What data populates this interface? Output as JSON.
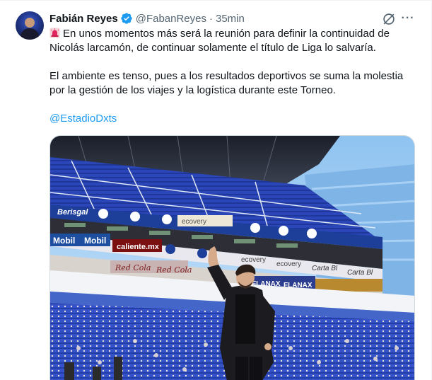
{
  "tweet": {
    "author_name": "Fabián Reyes",
    "handle": "@FabanReyes",
    "separator": "·",
    "time": "35min",
    "more_label": "···",
    "paragraph1": "En unos momentos más será la reunión para definir la continuidad de Nicolás larcamón, de continuar solamente el título de Liga lo salvaría.",
    "paragraph2": "El ambiente es tenso, pues a los resultados deportivos se suma la molestia por la gestión de los viajes y la logística durante este Torneo.",
    "mention": "@EstadioDxts",
    "emoji": "rotating-light-emoji"
  },
  "photo": {
    "signage": {
      "berisgal": "Berisgal",
      "ecovery": "ecovery",
      "mobil1": "Mobil",
      "mobil2": "Mobil",
      "caliente": "caliente.mx",
      "ecovery2": "ecovery",
      "ecovery3": "ecovery",
      "carta1": "Carta Bl",
      "carta2": "Carta Bl",
      "redcola1": "Red Cola",
      "redcola2": "Red Cola",
      "flanax1": "FLANAX",
      "flanax2": "FLANAX"
    }
  },
  "colors": {
    "verified": "#1d9bf0",
    "link": "#1d9bf0",
    "muted": "#536471",
    "seats": "#2a46b8"
  }
}
